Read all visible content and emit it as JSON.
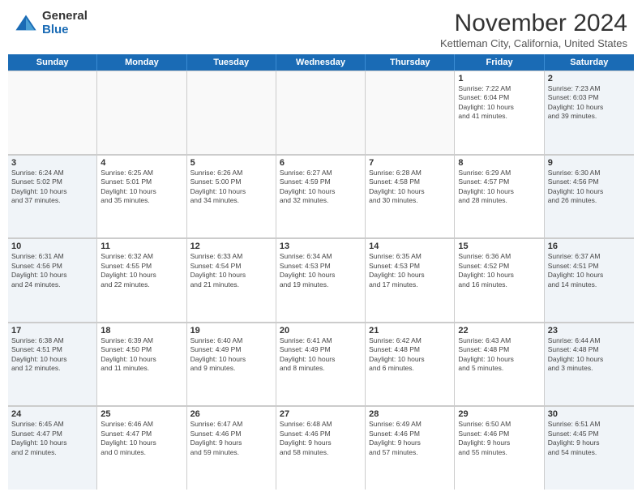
{
  "logo": {
    "general": "General",
    "blue": "Blue"
  },
  "title": "November 2024",
  "location": "Kettleman City, California, United States",
  "days_of_week": [
    "Sunday",
    "Monday",
    "Tuesday",
    "Wednesday",
    "Thursday",
    "Friday",
    "Saturday"
  ],
  "weeks": [
    [
      {
        "day": "",
        "info": "",
        "empty": true
      },
      {
        "day": "",
        "info": "",
        "empty": true
      },
      {
        "day": "",
        "info": "",
        "empty": true
      },
      {
        "day": "",
        "info": "",
        "empty": true
      },
      {
        "day": "",
        "info": "",
        "empty": true
      },
      {
        "day": "1",
        "info": "Sunrise: 7:22 AM\nSunset: 6:04 PM\nDaylight: 10 hours\nand 41 minutes."
      },
      {
        "day": "2",
        "info": "Sunrise: 7:23 AM\nSunset: 6:03 PM\nDaylight: 10 hours\nand 39 minutes."
      }
    ],
    [
      {
        "day": "3",
        "info": "Sunrise: 6:24 AM\nSunset: 5:02 PM\nDaylight: 10 hours\nand 37 minutes."
      },
      {
        "day": "4",
        "info": "Sunrise: 6:25 AM\nSunset: 5:01 PM\nDaylight: 10 hours\nand 35 minutes."
      },
      {
        "day": "5",
        "info": "Sunrise: 6:26 AM\nSunset: 5:00 PM\nDaylight: 10 hours\nand 34 minutes."
      },
      {
        "day": "6",
        "info": "Sunrise: 6:27 AM\nSunset: 4:59 PM\nDaylight: 10 hours\nand 32 minutes."
      },
      {
        "day": "7",
        "info": "Sunrise: 6:28 AM\nSunset: 4:58 PM\nDaylight: 10 hours\nand 30 minutes."
      },
      {
        "day": "8",
        "info": "Sunrise: 6:29 AM\nSunset: 4:57 PM\nDaylight: 10 hours\nand 28 minutes."
      },
      {
        "day": "9",
        "info": "Sunrise: 6:30 AM\nSunset: 4:56 PM\nDaylight: 10 hours\nand 26 minutes."
      }
    ],
    [
      {
        "day": "10",
        "info": "Sunrise: 6:31 AM\nSunset: 4:56 PM\nDaylight: 10 hours\nand 24 minutes."
      },
      {
        "day": "11",
        "info": "Sunrise: 6:32 AM\nSunset: 4:55 PM\nDaylight: 10 hours\nand 22 minutes."
      },
      {
        "day": "12",
        "info": "Sunrise: 6:33 AM\nSunset: 4:54 PM\nDaylight: 10 hours\nand 21 minutes."
      },
      {
        "day": "13",
        "info": "Sunrise: 6:34 AM\nSunset: 4:53 PM\nDaylight: 10 hours\nand 19 minutes."
      },
      {
        "day": "14",
        "info": "Sunrise: 6:35 AM\nSunset: 4:53 PM\nDaylight: 10 hours\nand 17 minutes."
      },
      {
        "day": "15",
        "info": "Sunrise: 6:36 AM\nSunset: 4:52 PM\nDaylight: 10 hours\nand 16 minutes."
      },
      {
        "day": "16",
        "info": "Sunrise: 6:37 AM\nSunset: 4:51 PM\nDaylight: 10 hours\nand 14 minutes."
      }
    ],
    [
      {
        "day": "17",
        "info": "Sunrise: 6:38 AM\nSunset: 4:51 PM\nDaylight: 10 hours\nand 12 minutes."
      },
      {
        "day": "18",
        "info": "Sunrise: 6:39 AM\nSunset: 4:50 PM\nDaylight: 10 hours\nand 11 minutes."
      },
      {
        "day": "19",
        "info": "Sunrise: 6:40 AM\nSunset: 4:49 PM\nDaylight: 10 hours\nand 9 minutes."
      },
      {
        "day": "20",
        "info": "Sunrise: 6:41 AM\nSunset: 4:49 PM\nDaylight: 10 hours\nand 8 minutes."
      },
      {
        "day": "21",
        "info": "Sunrise: 6:42 AM\nSunset: 4:48 PM\nDaylight: 10 hours\nand 6 minutes."
      },
      {
        "day": "22",
        "info": "Sunrise: 6:43 AM\nSunset: 4:48 PM\nDaylight: 10 hours\nand 5 minutes."
      },
      {
        "day": "23",
        "info": "Sunrise: 6:44 AM\nSunset: 4:48 PM\nDaylight: 10 hours\nand 3 minutes."
      }
    ],
    [
      {
        "day": "24",
        "info": "Sunrise: 6:45 AM\nSunset: 4:47 PM\nDaylight: 10 hours\nand 2 minutes."
      },
      {
        "day": "25",
        "info": "Sunrise: 6:46 AM\nSunset: 4:47 PM\nDaylight: 10 hours\nand 0 minutes."
      },
      {
        "day": "26",
        "info": "Sunrise: 6:47 AM\nSunset: 4:46 PM\nDaylight: 9 hours\nand 59 minutes."
      },
      {
        "day": "27",
        "info": "Sunrise: 6:48 AM\nSunset: 4:46 PM\nDaylight: 9 hours\nand 58 minutes."
      },
      {
        "day": "28",
        "info": "Sunrise: 6:49 AM\nSunset: 4:46 PM\nDaylight: 9 hours\nand 57 minutes."
      },
      {
        "day": "29",
        "info": "Sunrise: 6:50 AM\nSunset: 4:46 PM\nDaylight: 9 hours\nand 55 minutes."
      },
      {
        "day": "30",
        "info": "Sunrise: 6:51 AM\nSunset: 4:45 PM\nDaylight: 9 hours\nand 54 minutes."
      }
    ]
  ]
}
